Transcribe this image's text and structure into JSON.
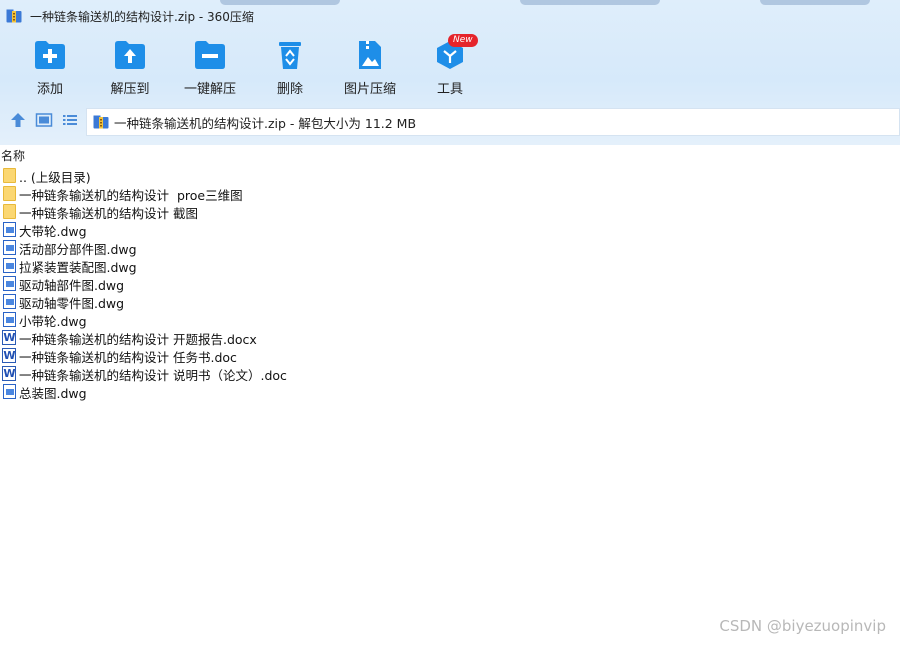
{
  "app": {
    "title": "一种链条输送机的结构设计.zip - 360压缩"
  },
  "toolbar": {
    "items": [
      {
        "label": "添加",
        "icon": "add-folder-icon"
      },
      {
        "label": "解压到",
        "icon": "extract-to-icon"
      },
      {
        "label": "一键解压",
        "icon": "one-click-extract-icon"
      },
      {
        "label": "删除",
        "icon": "recycle-delete-icon"
      },
      {
        "label": "图片压缩",
        "icon": "image-compress-icon"
      },
      {
        "label": "工具",
        "icon": "tools-cube-icon",
        "badge": "New"
      }
    ]
  },
  "nav": {
    "path": "一种链条输送机的结构设计.zip - 解包大小为 11.2 MB"
  },
  "list": {
    "column_name": "名称",
    "files": [
      {
        "name": ".. (上级目录)",
        "type": "folder"
      },
      {
        "name": "一种链条输送机的结构设计  proe三维图",
        "type": "folder"
      },
      {
        "name": "一种链条输送机的结构设计 截图",
        "type": "folder"
      },
      {
        "name": "大带轮.dwg",
        "type": "dwg"
      },
      {
        "name": "活动部分部件图.dwg",
        "type": "dwg"
      },
      {
        "name": "拉紧装置装配图.dwg",
        "type": "dwg"
      },
      {
        "name": "驱动轴部件图.dwg",
        "type": "dwg"
      },
      {
        "name": "驱动轴零件图.dwg",
        "type": "dwg"
      },
      {
        "name": "小带轮.dwg",
        "type": "dwg"
      },
      {
        "name": "一种链条输送机的结构设计 开题报告.docx",
        "type": "word"
      },
      {
        "name": "一种链条输送机的结构设计 任务书.doc",
        "type": "word"
      },
      {
        "name": "一种链条输送机的结构设计 说明书（论文）.doc",
        "type": "word"
      },
      {
        "name": "总装图.dwg",
        "type": "dwg"
      }
    ]
  },
  "watermark": "CSDN @biyezuopinvip",
  "colors": {
    "toolbar_bg": "#dbeaf8",
    "icon_blue": "#1e8ee8",
    "badge_red": "#e5242b",
    "folder_yellow": "#fbd772"
  }
}
